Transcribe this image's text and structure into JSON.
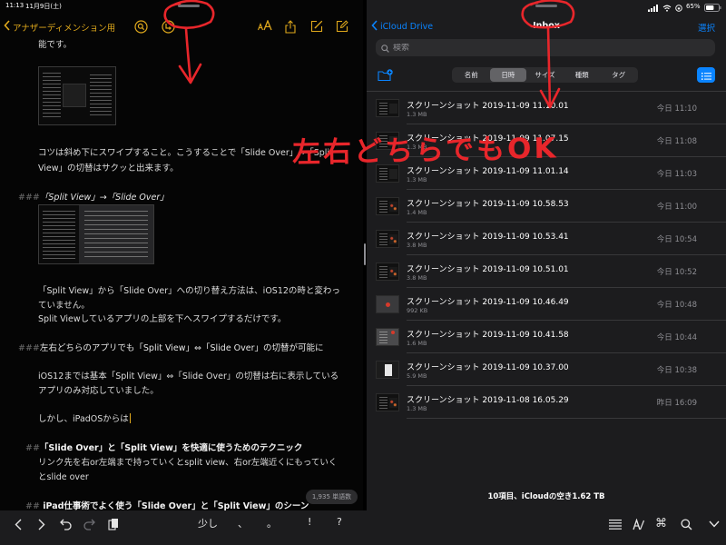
{
  "status_bar": {
    "time": "11:13",
    "date": "11月9日(土)",
    "battery": "65%"
  },
  "colors": {
    "notes_accent": "#e0a91c",
    "files_accent": "#0a84ff",
    "annotation": "#e8262b"
  },
  "notes": {
    "back_label": "アナザーディメンション用",
    "toolbar_icons": [
      "search-icon",
      "collaborate-icon",
      "text-format-icon",
      "share-icon",
      "markup-icon",
      "compose-icon"
    ],
    "lines": [
      "能です。",
      "コツは斜め下にスワイプすること。こうすることで「Slide Over」→「Split",
      "View」の切替はサクッと出来ます。",
      "「Split View」から「Slide Over」への切り替え方法は、iOS12の時と変わっ",
      "ていません。",
      "Split Viewしているアプリの上部を下へスワイプするだけです。",
      "iOS12までは基本「Split View」⇔「Slide Over」の切替は右に表示している",
      "アプリのみ対応していました。",
      "しかし、iPadOSからは",
      "リンク先を右or左端まで持っていくとsplit view、右or左端近くにもっていく",
      "とslide over"
    ],
    "headings": [
      {
        "marker": "###",
        "text": "「Split View」→「Slide Over」"
      },
      {
        "marker": "###",
        "text": "左右どちらのアプリでも「Split View」⇔「Slide Over」の切替が可能に"
      },
      {
        "marker": "##",
        "text": "「Slide Over」と「Split View」を快適に使うためのテクニック"
      },
      {
        "marker": "##",
        "text": " iPad仕事術でよく使う「Slide Over」と「Split View」のシーン"
      }
    ],
    "word_count": "1,935 単語数"
  },
  "keyboard_bar": {
    "shortcuts": [
      "少し",
      "、",
      "。",
      "!",
      "?"
    ],
    "icons": [
      "chevron-left-icon",
      "chevron-right-icon",
      "undo-icon",
      "redo-icon",
      "paste-icon",
      "list-icon",
      "text-style-icon",
      "command-icon",
      "search-icon",
      "chevron-down-icon"
    ]
  },
  "files": {
    "back_label": "iCloud Drive",
    "title": "Inbox",
    "select_label": "選択",
    "search_placeholder": "検索",
    "sort_options": [
      "名前",
      "日時",
      "サイズ",
      "種類",
      "タグ"
    ],
    "selected_sort_index": 1,
    "items": [
      {
        "name": "スクリーンショット 2019-11-09 11.10.01",
        "size": "1.3 MB",
        "modified": "今日 11:10"
      },
      {
        "name": "スクリーンショット 2019-11-09 11.07.15",
        "size": "1.3 MB",
        "modified": "今日 11:08"
      },
      {
        "name": "スクリーンショット 2019-11-09 11.01.14",
        "size": "1.3 MB",
        "modified": "今日 11:03"
      },
      {
        "name": "スクリーンショット 2019-11-09 10.58.53",
        "size": "1.4 MB",
        "modified": "今日 11:00"
      },
      {
        "name": "スクリーンショット 2019-11-09 10.53.41",
        "size": "3.8 MB",
        "modified": "今日 10:54"
      },
      {
        "name": "スクリーンショット 2019-11-09 10.51.01",
        "size": "3.8 MB",
        "modified": "今日 10:52"
      },
      {
        "name": "スクリーンショット 2019-11-09 10.46.49",
        "size": "992 KB",
        "modified": "今日 10:48"
      },
      {
        "name": "スクリーンショット 2019-11-09 10.41.58",
        "size": "1.6 MB",
        "modified": "今日 10:44"
      },
      {
        "name": "スクリーンショット 2019-11-09 10.37.00",
        "size": "5.9 MB",
        "modified": "今日 10:38"
      },
      {
        "name": "スクリーンショット 2019-11-08 16.05.29",
        "size": "1.3 MB",
        "modified": "昨日 16:09"
      }
    ],
    "footer": "10項目、iCloudの空き1.62 TB"
  },
  "annotation": {
    "text": "左右どちらでもOK"
  }
}
